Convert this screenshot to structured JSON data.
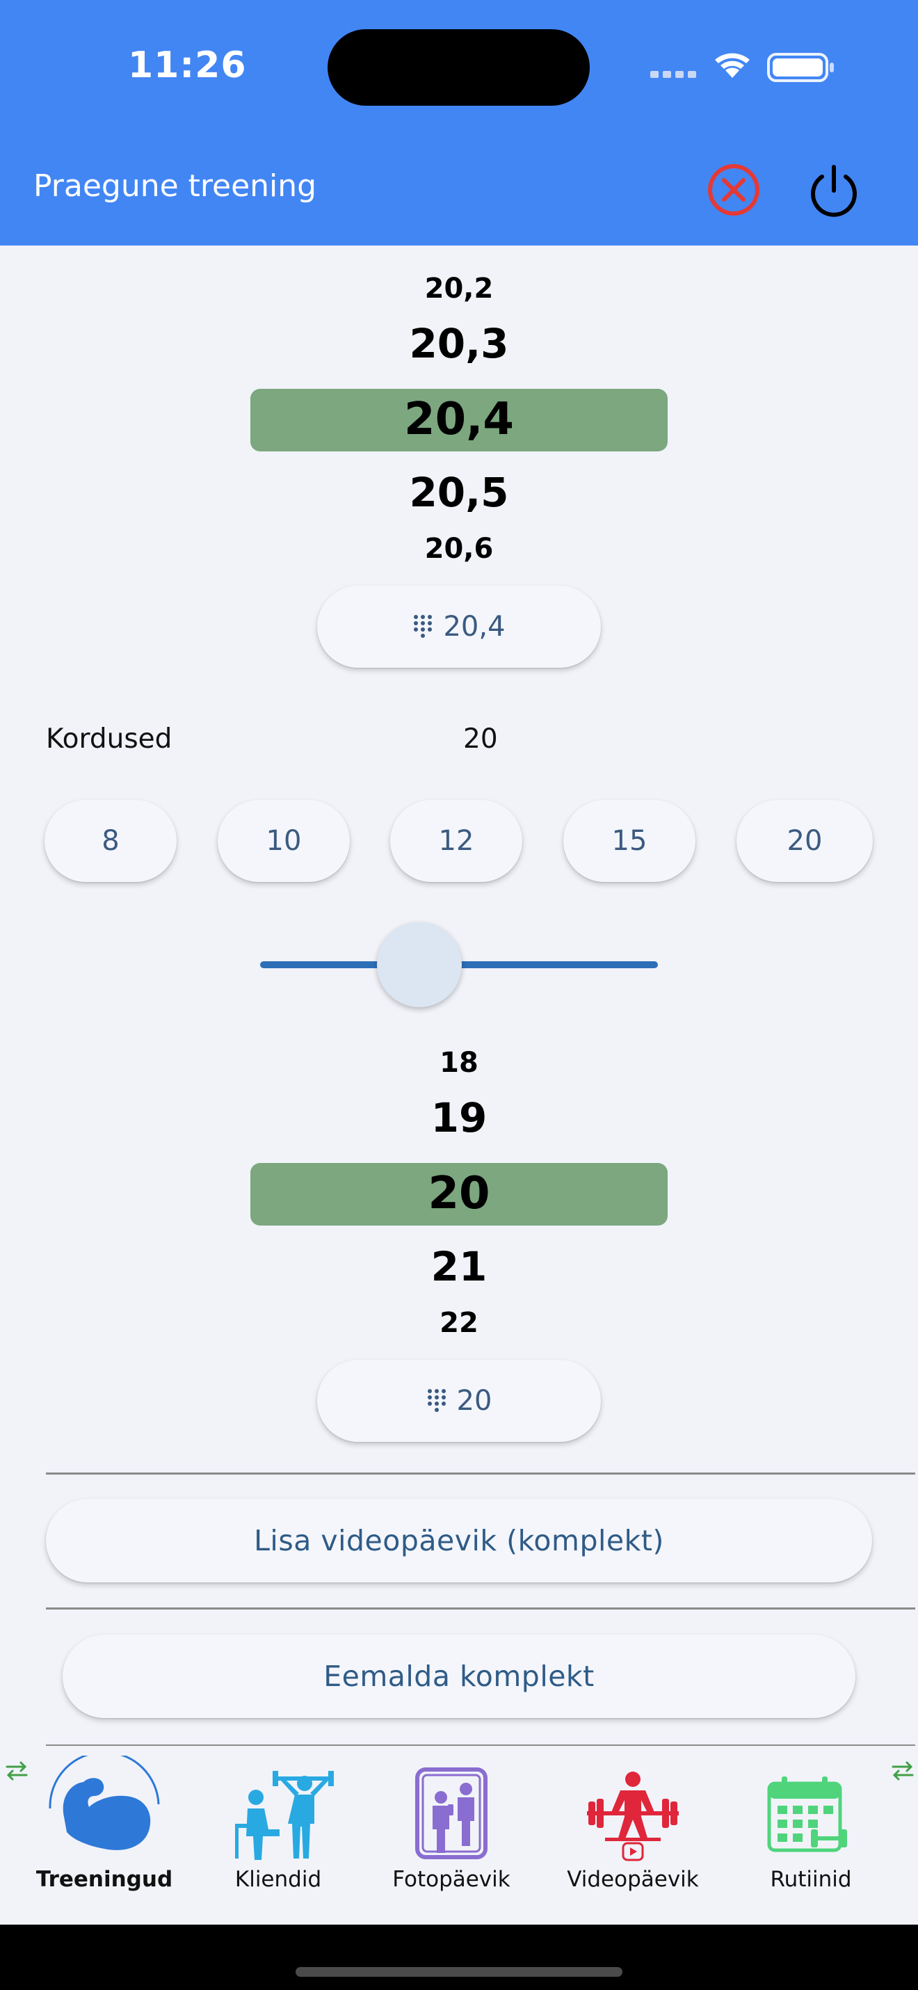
{
  "status_bar": {
    "time": "11:26"
  },
  "app_bar": {
    "title": "Praegune treening",
    "close_icon": "x-circle-icon",
    "power_icon": "power-icon",
    "accent_color": "#4286f4",
    "close_color": "#e53935"
  },
  "weight_picker": {
    "items": [
      "20,2",
      "20,3",
      "20,4",
      "20,5",
      "20,6"
    ],
    "selected": "20,4",
    "input_button_label": "20,4"
  },
  "reps": {
    "label": "Kordused",
    "value": "20",
    "presets": [
      "8",
      "10",
      "12",
      "15",
      "20"
    ],
    "picker_items": [
      "18",
      "19",
      "20",
      "21",
      "22"
    ],
    "selected": "20",
    "input_button_label": "20"
  },
  "actions": {
    "add_video_diary": "Lisa videopäevik (komplekt)",
    "remove_set": "Eemalda komplekt"
  },
  "bottom_nav": {
    "items": [
      {
        "label": "Treeningud",
        "icon": "flexed-arm-icon",
        "active": true
      },
      {
        "label": "Kliendid",
        "icon": "trainer-client-icon",
        "active": false
      },
      {
        "label": "Fotopäevik",
        "icon": "mirror-photo-icon",
        "active": false
      },
      {
        "label": "Videopäevik",
        "icon": "weightlifter-video-icon",
        "active": false
      },
      {
        "label": "Rutiinid",
        "icon": "calendar-dumbbell-icon",
        "active": false
      }
    ]
  },
  "colors": {
    "picker_highlight": "#7ca77f",
    "slider": "#2c6fb6",
    "button_text": "#2f5b86"
  }
}
